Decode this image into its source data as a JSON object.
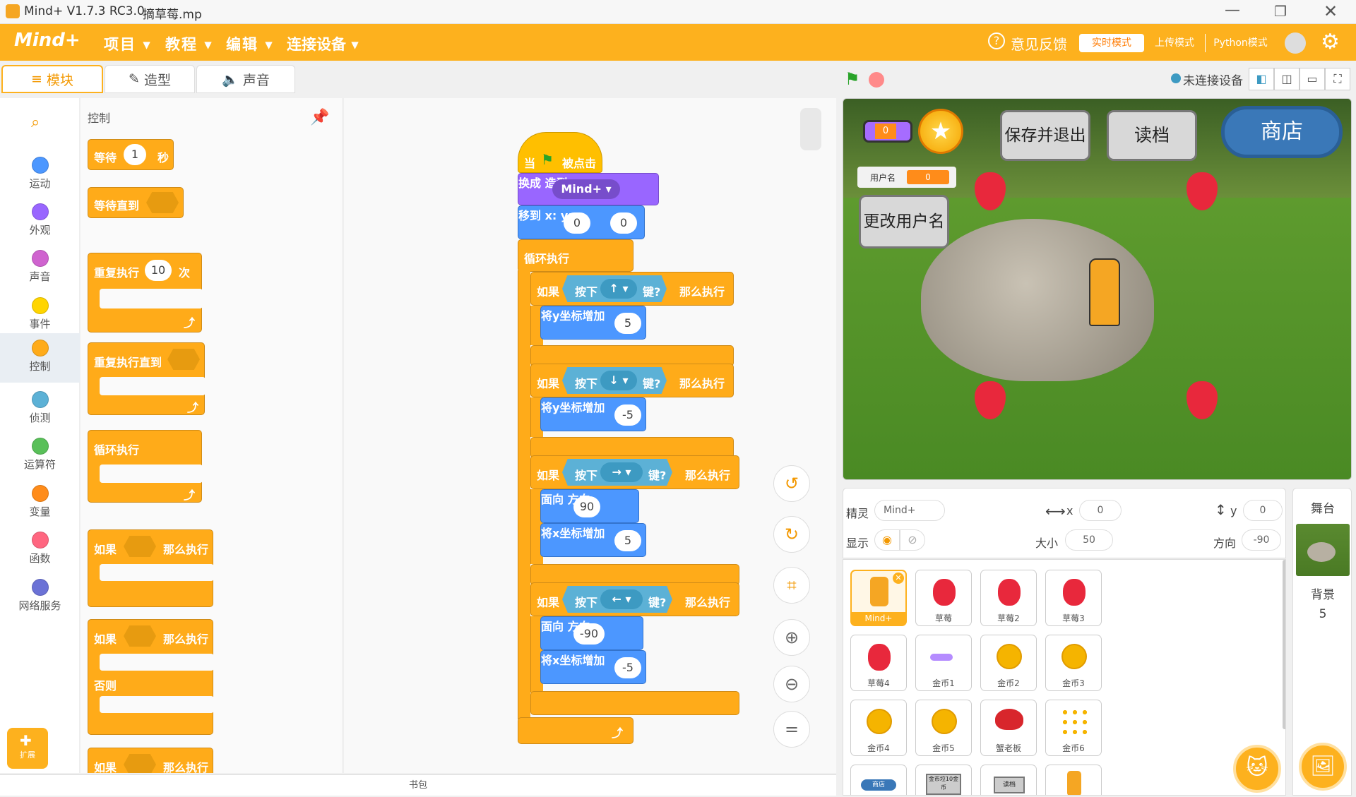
{
  "window": {
    "title": "Mind+ V1.7.3 RC3.0",
    "file": "摘草莓.mp"
  },
  "menu": {
    "logo": "Mind+",
    "items": [
      "项目",
      "教程",
      "编辑",
      "连接设备"
    ],
    "feedback": "意见反馈",
    "modes": [
      "实时模式",
      "上传模式",
      "Python模式"
    ]
  },
  "tabs": [
    "模块",
    "造型",
    "声音"
  ],
  "categories": [
    {
      "label": "运动",
      "color": "#4c97ff"
    },
    {
      "label": "外观",
      "color": "#9966ff"
    },
    {
      "label": "声音",
      "color": "#cf63cf"
    },
    {
      "label": "事件",
      "color": "#ffd500"
    },
    {
      "label": "控制",
      "color": "#ffab19"
    },
    {
      "label": "侦测",
      "color": "#5cb1d6"
    },
    {
      "label": "运算符",
      "color": "#59c059"
    },
    {
      "label": "变量",
      "color": "#ff8c1a"
    },
    {
      "label": "函数",
      "color": "#ff6680"
    },
    {
      "label": "网络服务",
      "color": "#6b72d6"
    }
  ],
  "extension_label": "扩展",
  "palette": {
    "section": "控制",
    "wait": "等待",
    "wait_val": "1",
    "wait_unit": "秒",
    "wait_until": "等待直到",
    "repeat": "重复执行",
    "repeat_val": "10",
    "repeat_unit": "次",
    "repeat_until": "重复执行直到",
    "forever": "循环执行",
    "if": "如果",
    "then": "那么执行",
    "else": "否则"
  },
  "script": {
    "hat": [
      "当",
      "被点击"
    ],
    "switch": {
      "label": "换成",
      "value": "Mind+",
      "unit": "造型"
    },
    "goto": {
      "label": "移到 x:",
      "x": "0",
      "ylabel": "y:",
      "y": "0"
    },
    "forever": "循环执行",
    "ifs": [
      {
        "key": "↑",
        "action": "将y坐标增加",
        "val": "5"
      },
      {
        "key": "↓",
        "action": "将y坐标增加",
        "val": "-5"
      },
      {
        "key": "→",
        "face": "90",
        "action": "将x坐标增加",
        "val": "5"
      },
      {
        "key": "←",
        "face": "-90",
        "action": "将x坐标增加",
        "val": "-5"
      }
    ],
    "if": "如果",
    "press": "按下",
    "key": "键?",
    "then": "那么执行",
    "face_label": "面向",
    "face_unit": "方向"
  },
  "backpack": "书包",
  "stage_status": "未连接设备",
  "stage": {
    "counter": "0",
    "username_label": "用户名",
    "username_val": "0",
    "save_exit": "保存并退出",
    "load": "读档",
    "shop": "商店",
    "rename": "更改用户名"
  },
  "sprite_info": {
    "sprite_label": "精灵",
    "sprite_name": "Mind+",
    "x_label": "x",
    "x": "0",
    "y_label": "y",
    "y": "0",
    "show_label": "显示",
    "size_label": "大小",
    "size": "50",
    "dir_label": "方向",
    "dir": "-90"
  },
  "sprites": [
    "Mind+",
    "草莓",
    "草莓2",
    "草莓3",
    "草莓4",
    "金币1",
    "金币2",
    "金币3",
    "金币4",
    "金币5",
    "蟹老板",
    "金币6"
  ],
  "partial_sprites": [
    "商店",
    "金币垃10金币",
    "读档"
  ],
  "backdrop": {
    "label": "舞台",
    "sub": "背景",
    "count": "5"
  }
}
